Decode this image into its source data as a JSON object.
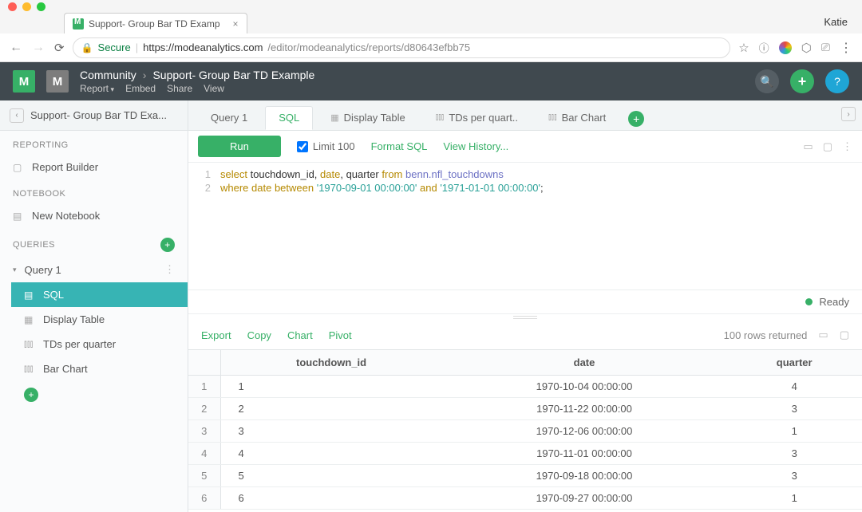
{
  "browser": {
    "user": "Katie",
    "tab_title": "Support- Group Bar TD Examp",
    "secure_label": "Secure",
    "url_host": "https://modeanalytics.com",
    "url_path": "/editor/modeanalytics/reports/d80643efbb75"
  },
  "header": {
    "community": "Community",
    "title": "Support- Group Bar TD Example",
    "menus": {
      "report": "Report",
      "embed": "Embed",
      "share": "Share",
      "view": "View"
    }
  },
  "tabbar": {
    "panel_title": "Support- Group Bar TD Exa...",
    "tabs": [
      {
        "label": "Query 1",
        "icon": ""
      },
      {
        "label": "SQL",
        "icon": ""
      },
      {
        "label": "Display Table",
        "icon": "table"
      },
      {
        "label": "TDs per quart..",
        "icon": "bars"
      },
      {
        "label": "Bar Chart",
        "icon": "bars"
      }
    ]
  },
  "sidebar": {
    "sections": {
      "reporting": "REPORTING",
      "notebook": "NOTEBOOK",
      "queries": "QUERIES"
    },
    "report_builder": "Report Builder",
    "new_notebook": "New Notebook",
    "query1": "Query 1",
    "children": {
      "sql": "SQL",
      "display_table": "Display Table",
      "tds": "TDs per quarter",
      "bar": "Bar Chart"
    }
  },
  "toolbar": {
    "run": "Run",
    "limit": "Limit 100",
    "format": "Format SQL",
    "history": "View History..."
  },
  "editor": {
    "lines": [
      {
        "n": "1",
        "tokens": [
          "select ",
          "touchdown_id",
          ", ",
          "date",
          ", ",
          "quarter",
          " from ",
          "benn.nfl_touchdowns"
        ]
      },
      {
        "n": "2",
        "tokens": [
          "where ",
          "date",
          " between ",
          "'1970-09-01 00:00:00'",
          " and ",
          "'1971-01-01 00:00:00'",
          ";"
        ]
      }
    ],
    "raw1": "select touchdown_id, date, quarter from benn.nfl_touchdowns",
    "raw2": "where date between '1970-09-01 00:00:00' and '1971-01-01 00:00:00';"
  },
  "status": {
    "ready": "Ready"
  },
  "results": {
    "links": {
      "export": "Export",
      "copy": "Copy",
      "chart": "Chart",
      "pivot": "Pivot"
    },
    "count": "100 rows returned",
    "columns": {
      "c1": "touchdown_id",
      "c2": "date",
      "c3": "quarter"
    },
    "rows": [
      {
        "n": "1",
        "id": "1",
        "date": "1970-10-04 00:00:00",
        "q": "4"
      },
      {
        "n": "2",
        "id": "2",
        "date": "1970-11-22 00:00:00",
        "q": "3"
      },
      {
        "n": "3",
        "id": "3",
        "date": "1970-12-06 00:00:00",
        "q": "1"
      },
      {
        "n": "4",
        "id": "4",
        "date": "1970-11-01 00:00:00",
        "q": "3"
      },
      {
        "n": "5",
        "id": "5",
        "date": "1970-09-18 00:00:00",
        "q": "3"
      },
      {
        "n": "6",
        "id": "6",
        "date": "1970-09-27 00:00:00",
        "q": "1"
      }
    ]
  },
  "chart_data": {
    "type": "table",
    "title": "Query 1 results",
    "columns": [
      "touchdown_id",
      "date",
      "quarter"
    ],
    "rows": [
      [
        1,
        "1970-10-04 00:00:00",
        4
      ],
      [
        2,
        "1970-11-22 00:00:00",
        3
      ],
      [
        3,
        "1970-12-06 00:00:00",
        1
      ],
      [
        4,
        "1970-11-01 00:00:00",
        3
      ],
      [
        5,
        "1970-09-18 00:00:00",
        3
      ],
      [
        6,
        "1970-09-27 00:00:00",
        1
      ]
    ]
  }
}
